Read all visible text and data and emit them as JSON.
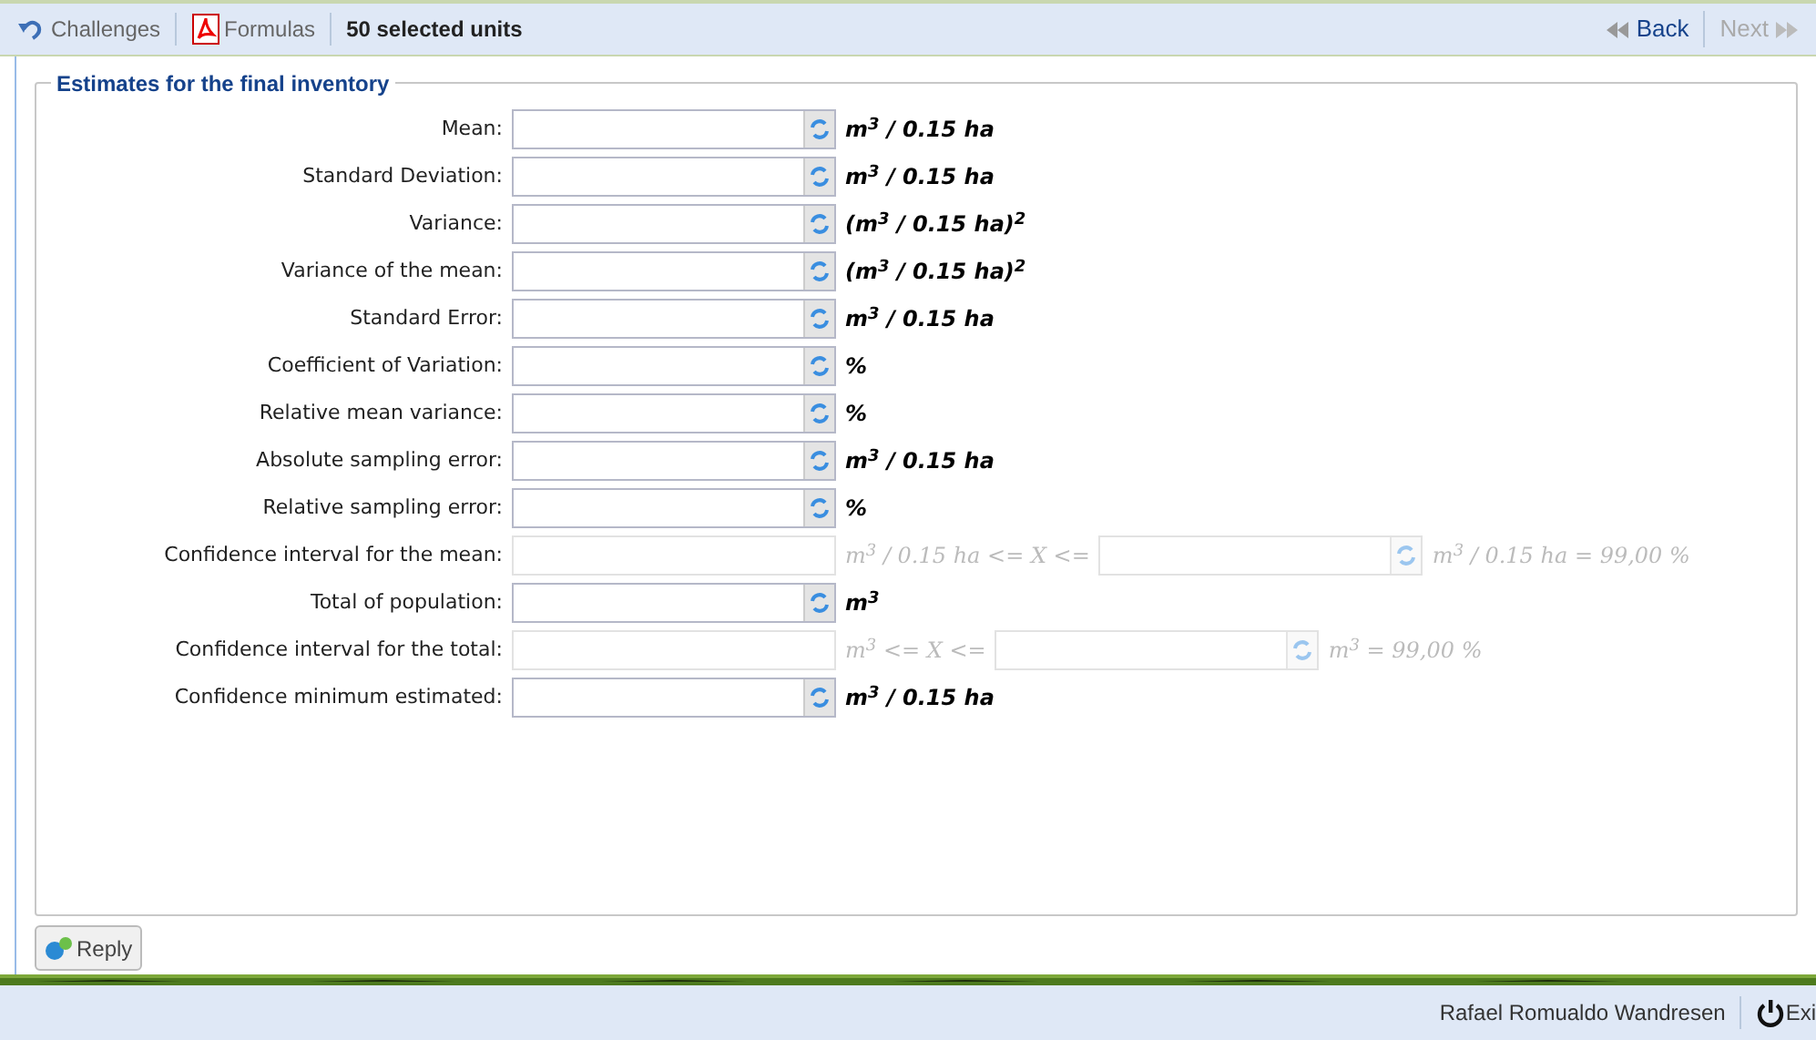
{
  "toolbar": {
    "challenges": "Challenges",
    "formulas": "Formulas",
    "selection": "50 selected units",
    "back": {
      "label": "Back",
      "disabled": false
    },
    "next": {
      "label": "Next",
      "disabled": true
    }
  },
  "fieldset": {
    "legend": "Estimates for the final inventory",
    "rows": [
      {
        "kind": "single",
        "label": "Mean:",
        "unit": "m$^{3}$ / 0.15 ha",
        "disabled": false
      },
      {
        "kind": "single",
        "label": "Standard Deviation:",
        "unit": "m$^{3}$ / 0.15 ha",
        "disabled": false
      },
      {
        "kind": "single",
        "label": "Variance:",
        "unit": "(m$^{3}$ / 0.15 ha)$^{2}$",
        "disabled": false
      },
      {
        "kind": "single",
        "label": "Variance of the mean:",
        "unit": "(m$^{3}$ / 0.15 ha)$^{2}$",
        "disabled": false
      },
      {
        "kind": "single",
        "label": "Standard Error:",
        "unit": "m$^{3}$ / 0.15 ha",
        "disabled": false
      },
      {
        "kind": "single",
        "label": "Coefficient of Variation:",
        "unit": "%",
        "disabled": false
      },
      {
        "kind": "single",
        "label": "Relative mean variance:",
        "unit": "%",
        "disabled": false
      },
      {
        "kind": "single",
        "label": "Absolute sampling error:",
        "unit": "m$^{3}$ / 0.15 ha",
        "disabled": false
      },
      {
        "kind": "single",
        "label": "Relative sampling error:",
        "unit": "%",
        "disabled": false
      },
      {
        "kind": "interval",
        "label": "Confidence interval for the mean:",
        "middle": "m$^{3}$ / 0.15 ha <= X <=",
        "unit": "m$^{3}$ / 0.15 ha = 99,00 %",
        "disabled": true
      },
      {
        "kind": "single",
        "label": "Total of population:",
        "unit": "m$^{3}$",
        "disabled": false
      },
      {
        "kind": "interval",
        "label": "Confidence interval for the total:",
        "middle": "m$^{3}$ <= X <=",
        "unit": "m$^{3}$ = 99,00 %",
        "disabled": true
      },
      {
        "kind": "single",
        "label": "Confidence minimum estimated:",
        "unit": "m$^{3}$ / 0.15 ha",
        "disabled": false
      }
    ]
  },
  "reply_button": "Reply",
  "footer": {
    "user": "Rafael Romualdo Wandresen",
    "exit": "Exi"
  }
}
